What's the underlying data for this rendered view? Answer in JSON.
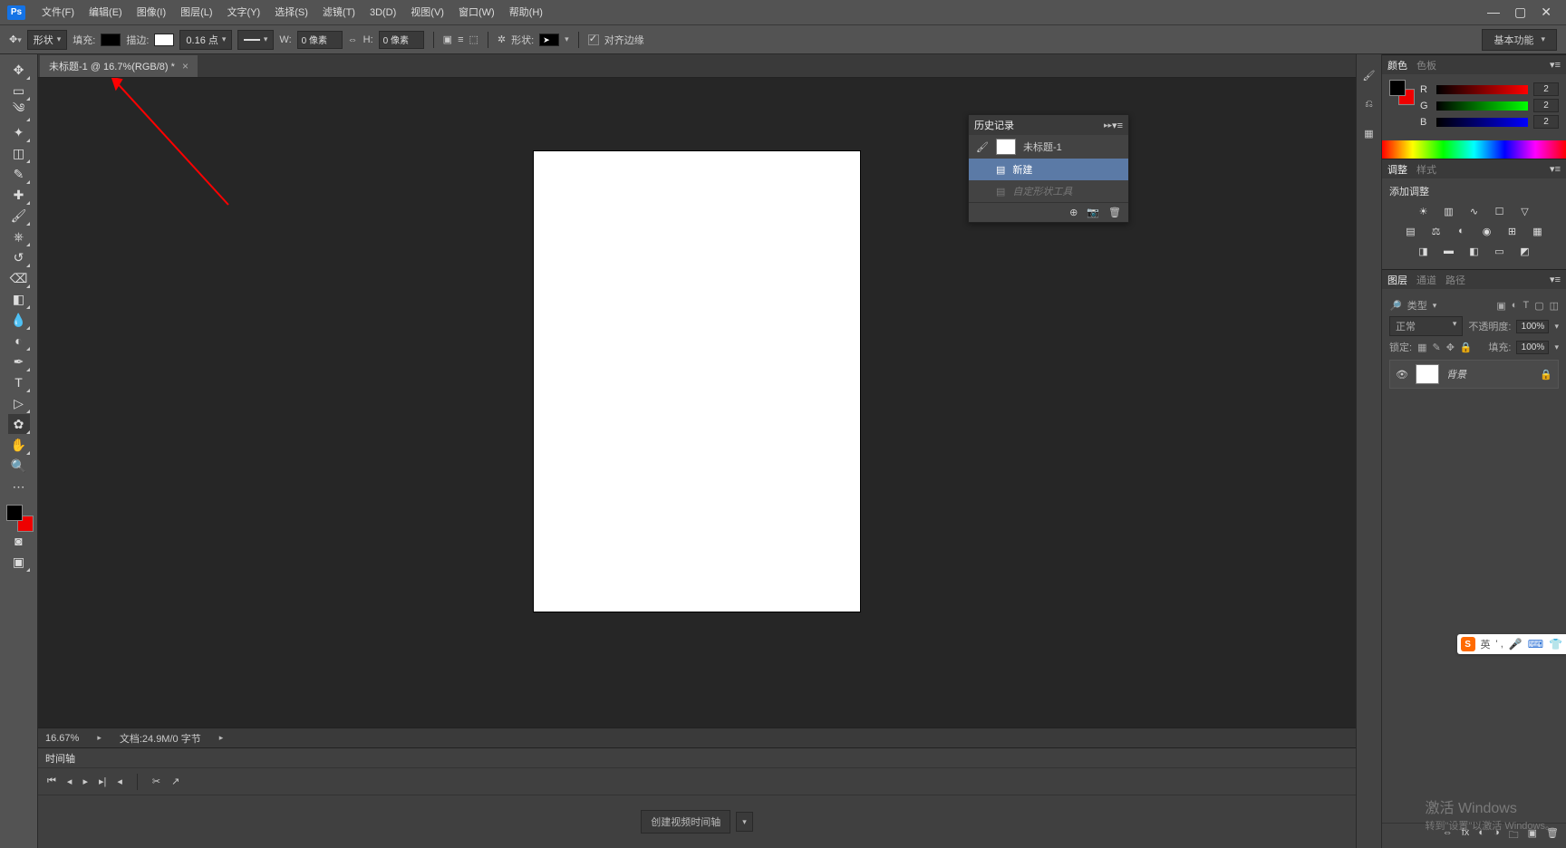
{
  "menu": {
    "items": [
      "文件(F)",
      "编辑(E)",
      "图像(I)",
      "图层(L)",
      "文字(Y)",
      "选择(S)",
      "滤镜(T)",
      "3D(D)",
      "视图(V)",
      "窗口(W)",
      "帮助(H)"
    ]
  },
  "options": {
    "shape_mode": "形状",
    "fill_label": "填充:",
    "stroke_label": "描边:",
    "stroke_size": "0.16 点",
    "w_label": "W:",
    "w_value": "0 像素",
    "h_label": "H:",
    "h_value": "0 像素",
    "shape_arrow": "形状:",
    "align_edges": "对齐边缘",
    "workspace": "基本功能"
  },
  "tab": {
    "title": "未标题-1 @ 16.7%(RGB/8) *"
  },
  "status": {
    "zoom": "16.67%",
    "doc": "文档:24.9M/0 字节"
  },
  "timeline": {
    "title": "时间轴",
    "create": "创建视频时间轴"
  },
  "history": {
    "title": "历史记录",
    "doc": "未标题-1",
    "items": [
      "新建",
      "自定形状工具"
    ]
  },
  "color": {
    "tab1": "颜色",
    "tab2": "色板",
    "r": "R",
    "g": "G",
    "b": "B",
    "rv": "2",
    "gv": "2",
    "bv": "2"
  },
  "adjust": {
    "tab1": "调整",
    "tab2": "样式",
    "add": "添加调整"
  },
  "layers": {
    "tab1": "图层",
    "tab2": "通道",
    "tab3": "路径",
    "kind": "类型",
    "mode": "正常",
    "opacity_lbl": "不透明度:",
    "opacity": "100%",
    "lock_lbl": "锁定:",
    "fill_lbl": "填充:",
    "fill": "100%",
    "layer_name": "背景"
  },
  "activate": {
    "line1": "激活 Windows",
    "line2": "转到\"设置\"以激活 Windows。"
  },
  "ime": {
    "lang": "英"
  }
}
